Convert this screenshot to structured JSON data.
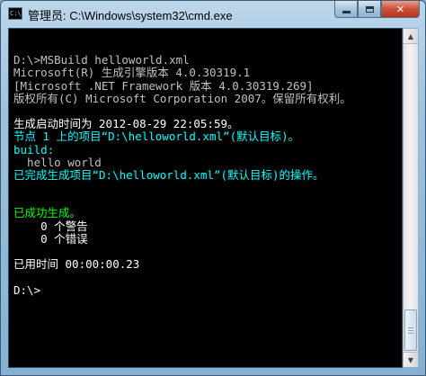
{
  "window": {
    "title": "管理员: C:\\Windows\\system32\\cmd.exe",
    "app_icon_text": "C:\\",
    "buttons": {
      "minimize": "",
      "maximize": "",
      "close": "✕"
    }
  },
  "console": {
    "lines": [
      {
        "text": "",
        "color": "gray"
      },
      {
        "text": "D:\\>MSBuild helloworld.xml",
        "color": "gray"
      },
      {
        "text": "Microsoft(R) 生成引擎版本 4.0.30319.1",
        "color": "gray"
      },
      {
        "text": "[Microsoft .NET Framework 版本 4.0.30319.269]",
        "color": "gray"
      },
      {
        "text": "版权所有(C) Microsoft Corporation 2007。保留所有权利。",
        "color": "gray"
      },
      {
        "text": "",
        "color": "gray"
      },
      {
        "text": "生成启动时间为 2012-08-29 22:05:59。",
        "color": "white"
      },
      {
        "text": "节点 1 上的项目“D:\\helloworld.xml”(默认目标)。",
        "color": "cyan"
      },
      {
        "text": "build:",
        "color": "cyan"
      },
      {
        "text": "  hello world",
        "color": "gray"
      },
      {
        "text": "已完成生成项目“D:\\helloworld.xml”(默认目标)的操作。",
        "color": "cyan"
      },
      {
        "text": "",
        "color": "gray"
      },
      {
        "text": "",
        "color": "gray"
      },
      {
        "text": "已成功生成。",
        "color": "green"
      },
      {
        "text": "    0 个警告",
        "color": "white"
      },
      {
        "text": "    0 个错误",
        "color": "white"
      },
      {
        "text": "",
        "color": "gray"
      },
      {
        "text": "已用时间 00:00:00.23",
        "color": "white"
      },
      {
        "text": "",
        "color": "gray"
      },
      {
        "text": "D:\\>",
        "color": "white"
      }
    ]
  },
  "colors": {
    "gray": "#c0c0c0",
    "white": "#ffffff",
    "cyan": "#00ffff",
    "green": "#00ff00"
  }
}
